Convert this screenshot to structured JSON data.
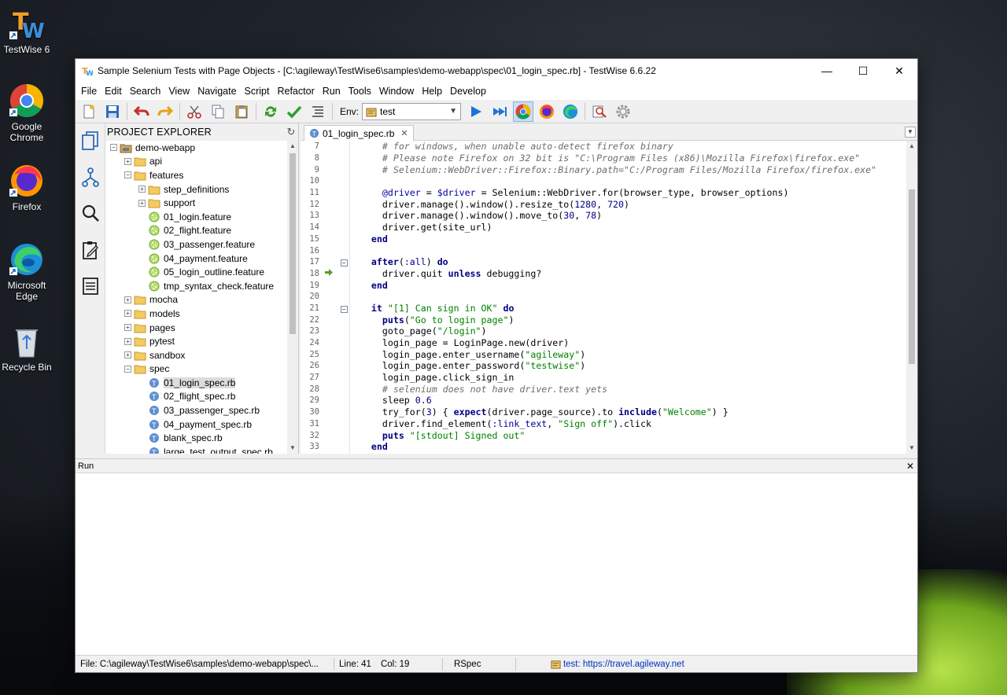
{
  "desktop": {
    "icons": [
      {
        "label": "TestWise 6"
      },
      {
        "label": "Google Chrome"
      },
      {
        "label": "Firefox"
      },
      {
        "label": "Microsoft Edge"
      },
      {
        "label": "Recycle Bin"
      }
    ]
  },
  "window": {
    "title": "Sample Selenium Tests with Page Objects - [C:\\agileway\\TestWise6\\samples\\demo-webapp\\spec\\01_login_spec.rb] - TestWise 6.6.22",
    "controls": {
      "minimize": "—",
      "maximize": "☐",
      "close": "✕"
    }
  },
  "menu": [
    "File",
    "Edit",
    "Search",
    "View",
    "Navigate",
    "Script",
    "Refactor",
    "Run",
    "Tools",
    "Window",
    "Help",
    "Develop"
  ],
  "toolbar": {
    "env_label": "Env:",
    "env_value": "test"
  },
  "explorer": {
    "title": "PROJECT EXPLORER",
    "items": [
      {
        "label": "demo-webapp",
        "depth": 0,
        "type": "project",
        "expanded": true
      },
      {
        "label": "api",
        "depth": 1,
        "type": "folder",
        "expanded": false
      },
      {
        "label": "features",
        "depth": 1,
        "type": "folder",
        "expanded": true
      },
      {
        "label": "step_definitions",
        "depth": 2,
        "type": "folder",
        "expanded": false
      },
      {
        "label": "support",
        "depth": 2,
        "type": "folder",
        "expanded": false
      },
      {
        "label": "01_login.feature",
        "depth": 2,
        "type": "feature"
      },
      {
        "label": "02_flight.feature",
        "depth": 2,
        "type": "feature"
      },
      {
        "label": "03_passenger.feature",
        "depth": 2,
        "type": "feature"
      },
      {
        "label": "04_payment.feature",
        "depth": 2,
        "type": "feature"
      },
      {
        "label": "05_login_outline.feature",
        "depth": 2,
        "type": "feature"
      },
      {
        "label": "tmp_syntax_check.feature",
        "depth": 2,
        "type": "feature"
      },
      {
        "label": "mocha",
        "depth": 1,
        "type": "folder",
        "expanded": false
      },
      {
        "label": "models",
        "depth": 1,
        "type": "folder",
        "expanded": false
      },
      {
        "label": "pages",
        "depth": 1,
        "type": "folder",
        "expanded": false
      },
      {
        "label": "pytest",
        "depth": 1,
        "type": "folder",
        "expanded": false
      },
      {
        "label": "sandbox",
        "depth": 1,
        "type": "folder",
        "expanded": false
      },
      {
        "label": "spec",
        "depth": 1,
        "type": "folder",
        "expanded": true
      },
      {
        "label": "01_login_spec.rb",
        "depth": 2,
        "type": "spec",
        "selected": true
      },
      {
        "label": "02_flight_spec.rb",
        "depth": 2,
        "type": "spec"
      },
      {
        "label": "03_passenger_spec.rb",
        "depth": 2,
        "type": "spec"
      },
      {
        "label": "04_payment_spec.rb",
        "depth": 2,
        "type": "spec"
      },
      {
        "label": "blank_spec.rb",
        "depth": 2,
        "type": "spec"
      },
      {
        "label": "large_test_output_spec.rb",
        "depth": 2,
        "type": "spec"
      }
    ]
  },
  "editor": {
    "tab_label": "01_login_spec.rb",
    "lines": [
      {
        "n": "7",
        "html": "      <span class='c'># for windows, when unable auto-detect firefox binary</span>"
      },
      {
        "n": "8",
        "html": "      <span class='c'># Please note Firefox on 32 bit is \"C:\\Program Files (x86)\\Mozilla Firefox\\firefox.exe\"</span>"
      },
      {
        "n": "9",
        "html": "      <span class='c'># Selenium::WebDriver::Firefox::Binary.path=\"C:/Program Files/Mozilla Firefox/firefox.exe\"</span>"
      },
      {
        "n": "10",
        "html": ""
      },
      {
        "n": "11",
        "html": "      <span class='iv'>@driver</span> = <span class='iv'>$driver</span> = Selenium::WebDriver.for(browser_type, browser_options)"
      },
      {
        "n": "12",
        "html": "      driver.manage().window().resize_to(<span class='n'>1280</span>, <span class='n'>720</span>)"
      },
      {
        "n": "13",
        "html": "      driver.manage().window().move_to(<span class='n'>30</span>, <span class='n'>78</span>)"
      },
      {
        "n": "14",
        "html": "      driver.get(site_url)"
      },
      {
        "n": "15",
        "html": "    <span class='k'>end</span>"
      },
      {
        "n": "16",
        "html": ""
      },
      {
        "n": "17",
        "html": "    <span class='k'>after</span>(<span class='sy'>:all</span>) <span class='k'>do</span>",
        "fold": true
      },
      {
        "n": "18",
        "html": "      driver.quit <span class='k'>unless</span> debugging?",
        "marker": true
      },
      {
        "n": "19",
        "html": "    <span class='k'>end</span>"
      },
      {
        "n": "20",
        "html": ""
      },
      {
        "n": "21",
        "html": "    <span class='k'>it</span> <span class='s'>\"[1] Can sign in OK\"</span> <span class='k'>do</span>",
        "fold": true
      },
      {
        "n": "22",
        "html": "      <span class='k'>puts</span>(<span class='s'>\"Go to login page\"</span>)"
      },
      {
        "n": "23",
        "html": "      goto_page(<span class='s'>\"/login\"</span>)"
      },
      {
        "n": "24",
        "html": "      login_page = LoginPage.new(driver)"
      },
      {
        "n": "25",
        "html": "      login_page.enter_username(<span class='s'>\"agileway\"</span>)"
      },
      {
        "n": "26",
        "html": "      login_page.enter_password(<span class='s'>\"testwise\"</span>)"
      },
      {
        "n": "27",
        "html": "      login_page.click_sign_in"
      },
      {
        "n": "28",
        "html": "      <span class='c'># selenium does not have driver.text yets</span>"
      },
      {
        "n": "29",
        "html": "      sleep <span class='n'>0.6</span>"
      },
      {
        "n": "30",
        "html": "      try_for(<span class='n'>3</span>) { <span class='k'>expect</span>(driver.page_source).to <span class='k'>include</span>(<span class='s'>\"Welcome\"</span>) }"
      },
      {
        "n": "31",
        "html": "      driver.find_element(<span class='sy'>:link_text</span>, <span class='s'>\"Sign off\"</span>).click"
      },
      {
        "n": "32",
        "html": "      <span class='k'>puts</span> <span class='s'>\"[stdout] Signed out\"</span>"
      },
      {
        "n": "33",
        "html": "    <span class='k'>end</span>"
      }
    ]
  },
  "run_panel": {
    "title": "Run",
    "close": "✕"
  },
  "status": {
    "file": "File: C:\\agileway\\TestWise6\\samples\\demo-webapp\\spec\\...",
    "line": "Line: 41",
    "col": "Col: 19",
    "mode": "RSpec",
    "env_link": "test: https://travel.agileway.net"
  },
  "colors": {
    "accent": "#0078d7",
    "keyword": "#000080",
    "string": "#008000",
    "comment": "#6d6d6d"
  }
}
